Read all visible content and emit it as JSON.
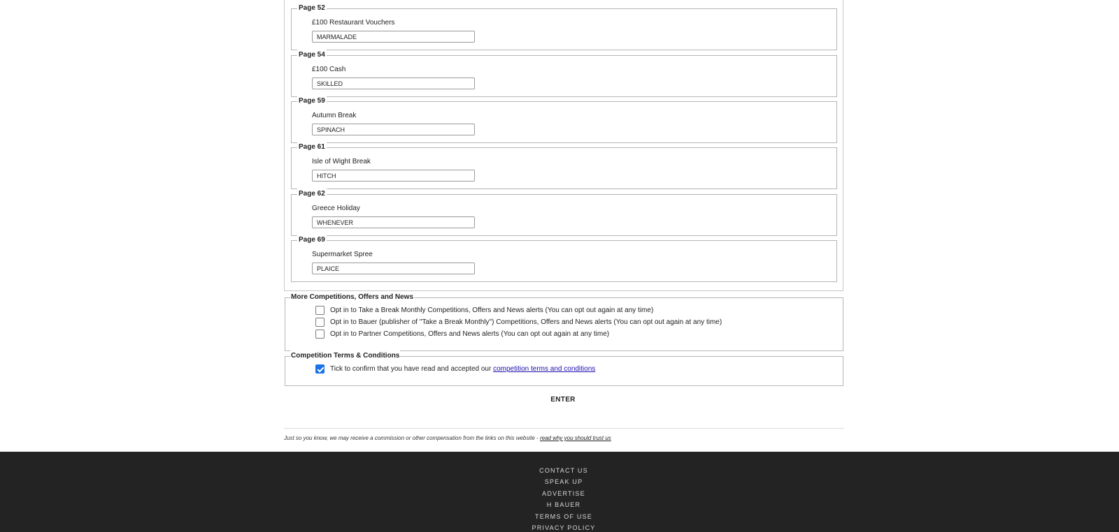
{
  "entries": [
    {
      "page": "Page 52",
      "prize": "£100 Restaurant Vouchers",
      "answer": "MARMALADE"
    },
    {
      "page": "Page 54",
      "prize": "£100 Cash",
      "answer": "SKILLED"
    },
    {
      "page": "Page 59",
      "prize": "Autumn Break",
      "answer": "SPINACH"
    },
    {
      "page": "Page 61",
      "prize": "Isle of Wight Break",
      "answer": "HITCH"
    },
    {
      "page": "Page 62",
      "prize": "Greece Holiday",
      "answer": "WHENEVER"
    },
    {
      "page": "Page 69",
      "prize": "Supermarket Spree",
      "answer": "PLAICE"
    }
  ],
  "more": {
    "legend": "More Competitions, Offers and News",
    "options": [
      {
        "label": "Opt in to Take a Break Monthly Competitions, Offers and News alerts (You can opt out again at any time)",
        "checked": false
      },
      {
        "label": "Opt in to Bauer (publisher of \"Take a Break Monthly\") Competitions, Offers and News alerts (You can opt out again at any time)",
        "checked": false
      },
      {
        "label": "Opt in to Partner Competitions, Offers and News alerts (You can opt out again at any time)",
        "checked": false
      }
    ]
  },
  "terms": {
    "legend": "Competition Terms & Conditions",
    "label": "Tick to confirm that you have read and accepted our",
    "link": "competition terms and conditions",
    "checked": true
  },
  "enter_label": "ENTER",
  "disclaimer": {
    "text": "Just so you know, we may receive a commission or other compensation from the links on this website -",
    "link": "read why you should trust us"
  },
  "footer": {
    "links": [
      "Contact Us",
      "Speak Up",
      "Advertise",
      "H Bauer",
      "Terms of Use",
      "Privacy Policy"
    ]
  }
}
